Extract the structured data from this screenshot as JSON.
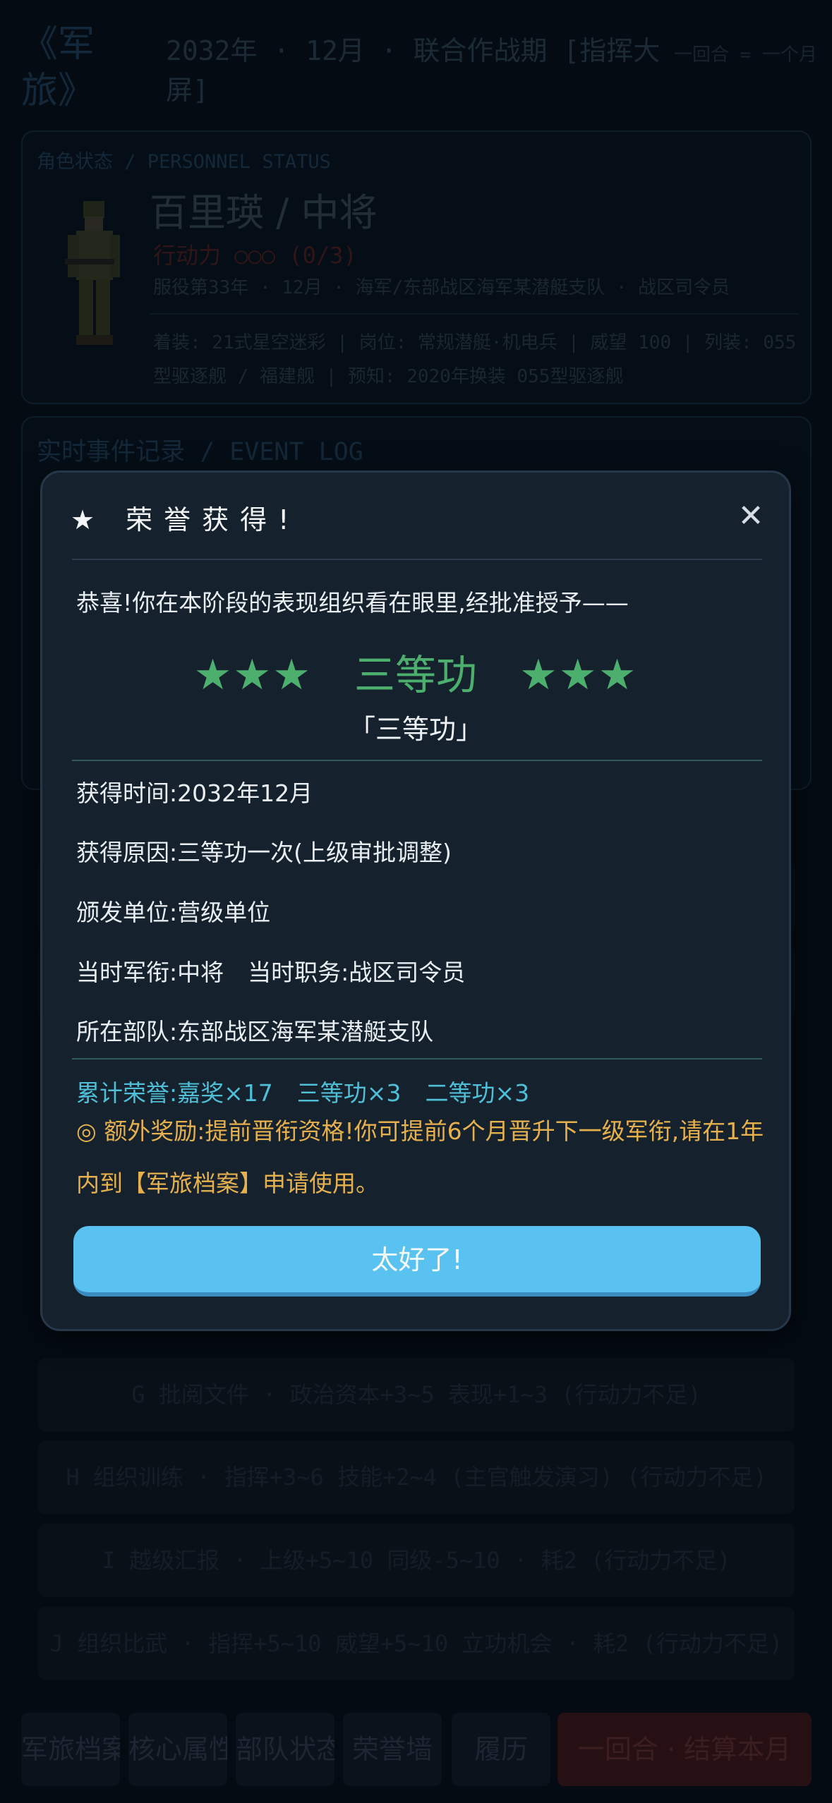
{
  "header": {
    "logo": "《军旅》",
    "date_line": "2032年 · 12月 · 联合作战期 [指挥大屏]",
    "turn_note": "一回合 = 一个月"
  },
  "status": {
    "section_label": "角色状态 / PERSONNEL STATUS",
    "name_rank": "百里瑛 / 中将",
    "action_points": "行动力 ○○○ (0/3)",
    "service_line": "服役第33年 · 12月 · 海军/东部战区海军某潜艇支队 · 战区司令员",
    "equipment_line": "着装: 21式星空迷彩 | 岗位: 常规潜艇·机电兵 | 威望 100 | 列装: 055型驱逐舰 / 福建舰 | 预知: 2020年换装 055型驱逐舰"
  },
  "event_log": {
    "section_label": "实时事件记录 / EVENT LOG"
  },
  "actions": [
    {
      "label": "G 批阅文件 · 政治资本+3~5 表现+1~3 (行动力不足)"
    },
    {
      "label": "H 组织训练 · 指挥+3~6 技能+2~4 (主官触发演习) (行动力不足)"
    },
    {
      "label": "I 越级汇报 · 上级+5~10 同级-5~10 · 耗2 (行动力不足)"
    },
    {
      "label": "J 组织比武 · 指挥+5~10 威望+5~10 立功机会 · 耗2 (行动力不足)"
    }
  ],
  "nav": {
    "archive": "军旅档案",
    "attributes": "核心属性",
    "unit": "部队状态",
    "honor_wall": "荣誉墙",
    "resume": "履历",
    "end_turn": "一回合 · 结算本月"
  },
  "modal": {
    "title": "★ 荣誉获得!",
    "close": "✕",
    "intro": "恭喜!你在本阶段的表现组织看在眼里,经批准授予——",
    "merit_stars": "★★★",
    "merit_name": "三等功",
    "merit_quoted": "「三等功」",
    "time_label": "获得时间:",
    "time_value": "2032年12月",
    "reason_label": "获得原因:",
    "reason_value": "三等功一次(上级审批调整)",
    "issuer_label": "颁发单位:",
    "issuer_value": "营级单位",
    "rank_label": "当时军衔:",
    "rank_value": "中将",
    "post_label": "当时职务:",
    "post_value": "战区司令员",
    "unit_label": "所在部队:",
    "unit_value": "东部战区海军某潜艇支队",
    "total_label": "累计荣誉:",
    "total_1": "嘉奖×17",
    "total_2": "三等功×3",
    "total_3": "二等功×3",
    "bonus": "◎ 额外奖励:提前晋衔资格!你可提前6个月晋升下一级军衔,请在1年内到【军旅档案】申请使用。",
    "confirm_button": "太好了!"
  },
  "colors": {
    "modal_bg": "#15222e",
    "merit_green": "#4caf6e",
    "total_cyan": "#4fbfd8",
    "bonus_gold": "#e6b04c",
    "button_blue": "#59c2f0"
  }
}
